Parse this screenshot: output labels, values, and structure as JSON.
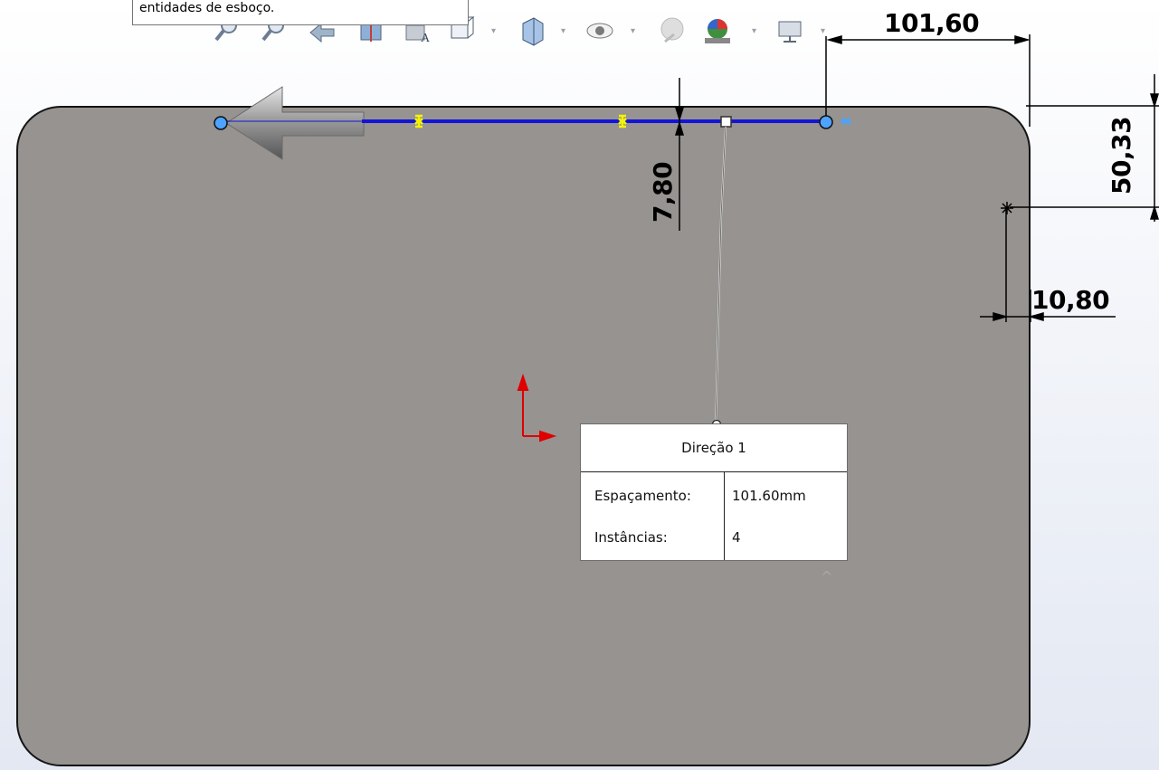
{
  "tooltip": {
    "text": "entidades de esboço."
  },
  "toolbar": {
    "icons": [
      "zoom-to-fit-icon",
      "zoom-to-area-icon",
      "previous-view-icon",
      "section-view-icon",
      "dynamic-annotation-icon",
      "view-orientation-icon",
      "display-style-icon",
      "hide-show-items-icon",
      "edit-appearance-icon",
      "apply-scene-icon",
      "view-settings-icon"
    ],
    "caret": "▾"
  },
  "dimensions": {
    "horizontal_top": "101,60",
    "vertical_right": "50,33",
    "vertical_left": "7,80",
    "horizontal_right": "10,80"
  },
  "pattern_callout": {
    "title": "Direção 1",
    "spacing_label": "Espaçamento:",
    "spacing_value": "101.60mm",
    "instances_label": "Instâncias:",
    "instances_value": "4",
    "collapse_glyph": "^"
  },
  "colors": {
    "part_face": "#969390",
    "sketch_line": "#1414d8",
    "endpoint": "#4da3ff",
    "midpoint_marker": "#f4f400",
    "origin_axes": "#e00000",
    "dimension_line": "#000000"
  }
}
